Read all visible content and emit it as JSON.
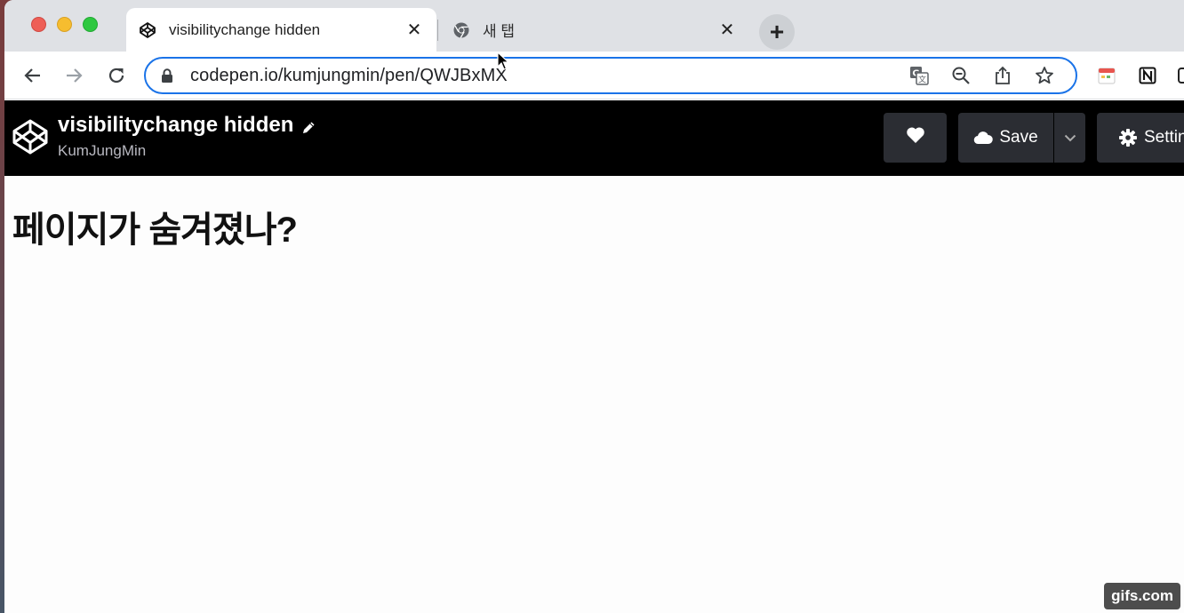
{
  "browser": {
    "tabs": [
      {
        "title": "visibilitychange hidden",
        "icon": "codepen-icon",
        "active": true
      },
      {
        "title": "새 탭",
        "icon": "chrome-icon",
        "active": false
      }
    ],
    "close_glyph": "✕",
    "new_tab_glyph": "+",
    "url": "codepen.io/kumjungmin/pen/QWJBxMX",
    "accent": "#1a73e8"
  },
  "codepen": {
    "pen_title": "visibilitychange hidden",
    "author": "KumJungMin",
    "save_label": "Save",
    "settings_label": "Settings",
    "header_bg": "#000000",
    "button_bg": "#2b2d33"
  },
  "page": {
    "heading": "페이지가 숨겨졌나?"
  },
  "watermark": "gifs.com"
}
